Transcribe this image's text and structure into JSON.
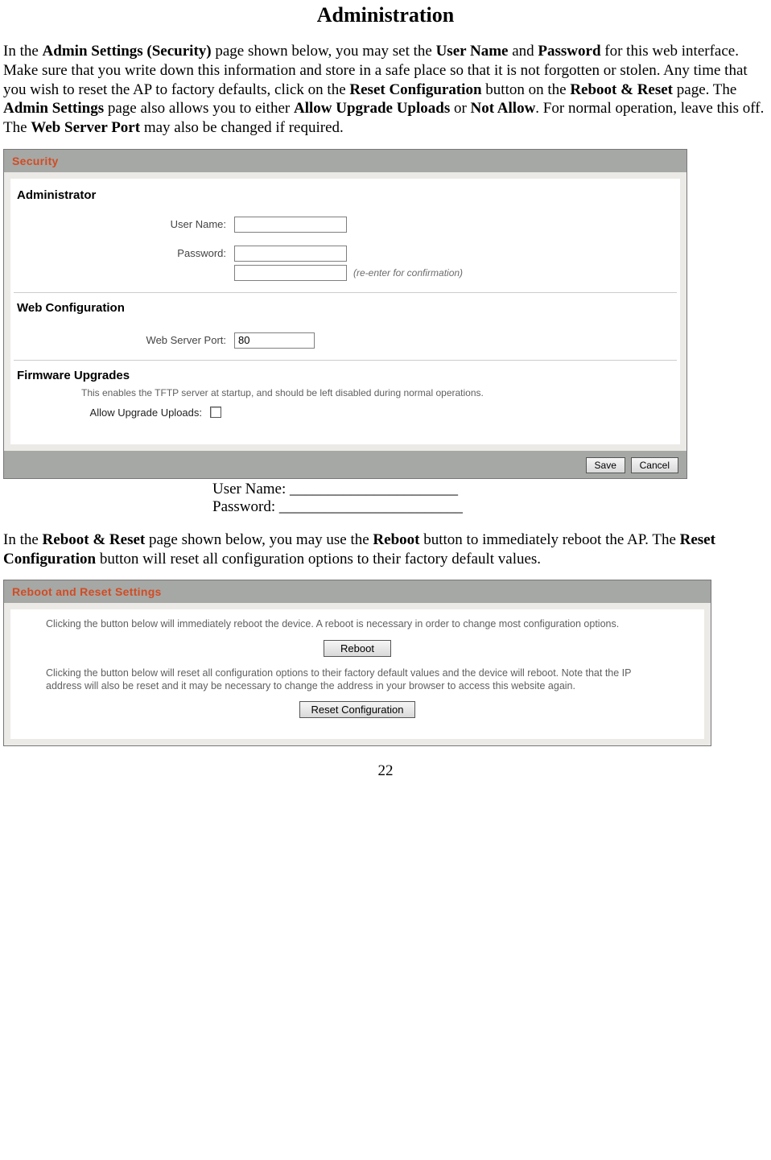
{
  "page": {
    "title": "Administration",
    "number": "22"
  },
  "intro": {
    "t1a": "In the ",
    "b1": "Admin Settings (Security)",
    "t1b": " page shown below, you may set the ",
    "b2": "User Name",
    "t1c": " and ",
    "b3": "Password",
    "t1d": " for this web interface.  Make sure that you write down this information and store in a safe place so that it is not forgotten or stolen.  Any time that you wish to reset the AP to factory defaults, click on the ",
    "b4": "Reset Configuration",
    "t1e": " button on the ",
    "b5": "Reboot & Reset",
    "t1f": " page. The ",
    "b6": "Admin Settings",
    "t1g": " page also allows you to either ",
    "b7": "Allow Upgrade Uploads",
    "t1h": " or ",
    "b8": "Not Allow",
    "t1i": ".  For normal operation, leave this off.  The ",
    "b9": "Web Server Port",
    "t1j": " may also be changed if required."
  },
  "security_panel": {
    "header": "Security",
    "admin_title": "Administrator",
    "username_label": "User Name:",
    "username_value": "",
    "password_label": "Password:",
    "password_value": "",
    "password_confirm_value": "",
    "confirm_hint": "(re-enter for confirmation)",
    "webconf_title": "Web Configuration",
    "webport_label": "Web Server Port:",
    "webport_value": "80",
    "firmware_title": "Firmware Upgrades",
    "firmware_help": "This enables the TFTP server at startup, and should be left disabled during normal operations.",
    "upload_label": "Allow Upgrade Uploads:",
    "save_btn": "Save",
    "cancel_btn": "Cancel"
  },
  "blanks": {
    "user_line": "User Name:  ______________________",
    "pass_line": "Password:  ________________________"
  },
  "mid_para": {
    "a": "In the ",
    "b1": "Reboot & Reset",
    "b": " page shown below, you may use the ",
    "b2": "Reboot",
    "c": " button to immediately reboot the AP.  The ",
    "b3": "Reset Configuration",
    "d": " button will reset all configuration options to their factory default values."
  },
  "reboot_panel": {
    "header": "Reboot and Reset Settings",
    "text1": "Clicking the button below will immediately reboot the device. A reboot is necessary in order to change most configuration options.",
    "reboot_btn": "Reboot",
    "text2": "Clicking the button below will reset all configuration options to their factory default values and the device will reboot. Note that the IP address will also be reset and it may be necessary to change the address in your browser to access this website again.",
    "reset_btn": "Reset Configuration"
  }
}
